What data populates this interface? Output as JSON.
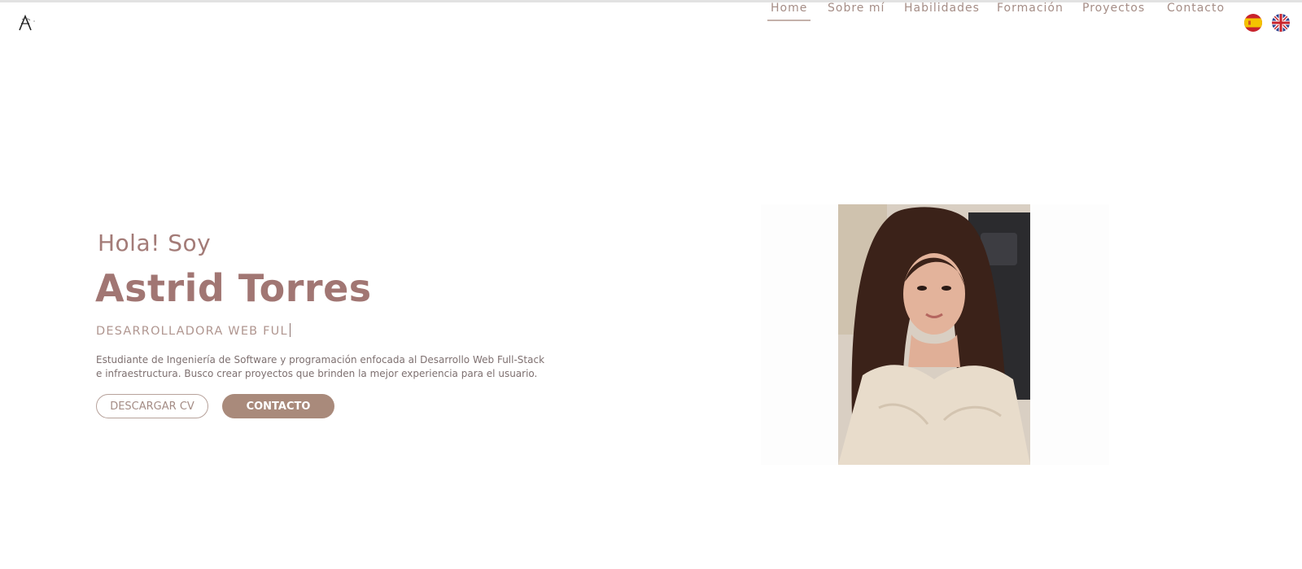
{
  "nav": {
    "items": [
      {
        "label": "Home",
        "active": true
      },
      {
        "label": "Sobre mí",
        "active": false
      },
      {
        "label": "Habilidades",
        "active": false
      },
      {
        "label": "Formación",
        "active": false
      },
      {
        "label": "Proyectos",
        "active": false
      },
      {
        "label": "Contacto",
        "active": false
      }
    ],
    "languages": [
      "es-flag-icon",
      "uk-flag-icon"
    ]
  },
  "hero": {
    "greeting": "Hola! Soy",
    "name": "Astrid Torres",
    "role": "DESARROLLADORA WEB FUL",
    "description": "Estudiante de Ingeniería de Software y programación enfocada al Desarrollo Web Full-Stack e infraestructura. Busco crear proyectos que brinden la mejor experiencia para el usuario.",
    "buttons": {
      "download_cv": "DESCARGAR CV",
      "contact": "CONTACTO"
    }
  },
  "colors": {
    "accent": "#a17673",
    "button": "#a98a7b"
  }
}
